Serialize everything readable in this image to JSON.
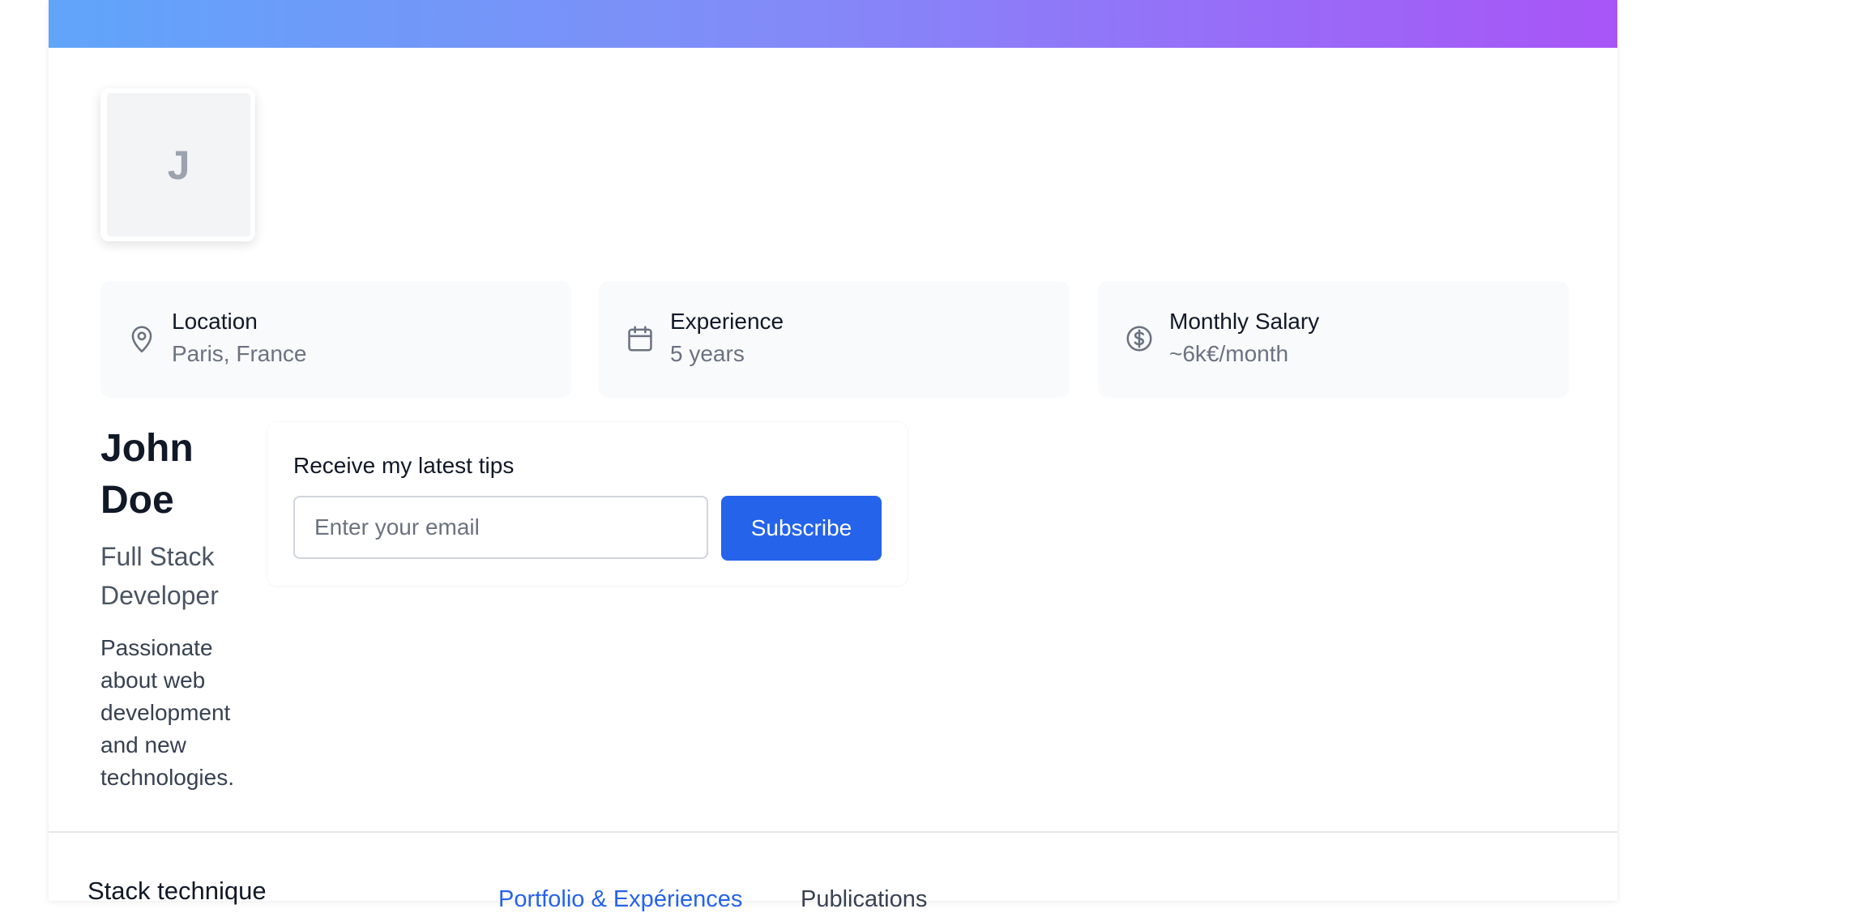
{
  "profile": {
    "avatar_initial": "J",
    "name": "John Doe",
    "role": "Full Stack Developer",
    "bio": "Passionate about web development and new technologies."
  },
  "info_cards": [
    {
      "icon": "map-pin-icon",
      "label": "Location",
      "value": "Paris, France"
    },
    {
      "icon": "calendar-icon",
      "label": "Experience",
      "value": "5 years"
    },
    {
      "icon": "dollar-icon",
      "label": "Monthly Salary",
      "value": "~6k€/month"
    }
  ],
  "newsletter": {
    "title": "Receive my latest tips",
    "email_value": "",
    "email_placeholder": "Enter your email",
    "subscribe_label": "Subscribe"
  },
  "bottom": {
    "stack_title": "Stack technique",
    "tabs": [
      {
        "label": "Portfolio & Expériences",
        "active": true
      },
      {
        "label": "Publications",
        "active": false
      }
    ]
  },
  "colors": {
    "banner_start": "#60a5fa",
    "banner_mid": "#818cf8",
    "banner_end": "#a855f7",
    "accent": "#2563eb",
    "info_card_bg": "#f8fafc"
  }
}
